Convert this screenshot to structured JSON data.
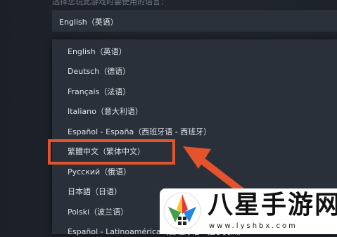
{
  "prompt": "选择您玩此游戏时要使用的语言：",
  "selected_language": "English（英语）",
  "languages": [
    "English（英语）",
    "Deutsch（德语）",
    "Français（法语）",
    "Italiano（意大利语）",
    "Español - España（西班牙语 - 西班牙）",
    "繁體中文（繁体中文）",
    "Русский（俄语）",
    "日本語（日语）",
    "Polski（波兰语）",
    "Español - Latinoamérica（西班牙语 - 拉丁美洲）"
  ],
  "annotation": {
    "highlight_color": "#e4532c",
    "highlighted_item": "繁體中文（繁体中文）"
  },
  "watermark": {
    "title": "八星手游网",
    "url": "www.lyshbx.com"
  }
}
